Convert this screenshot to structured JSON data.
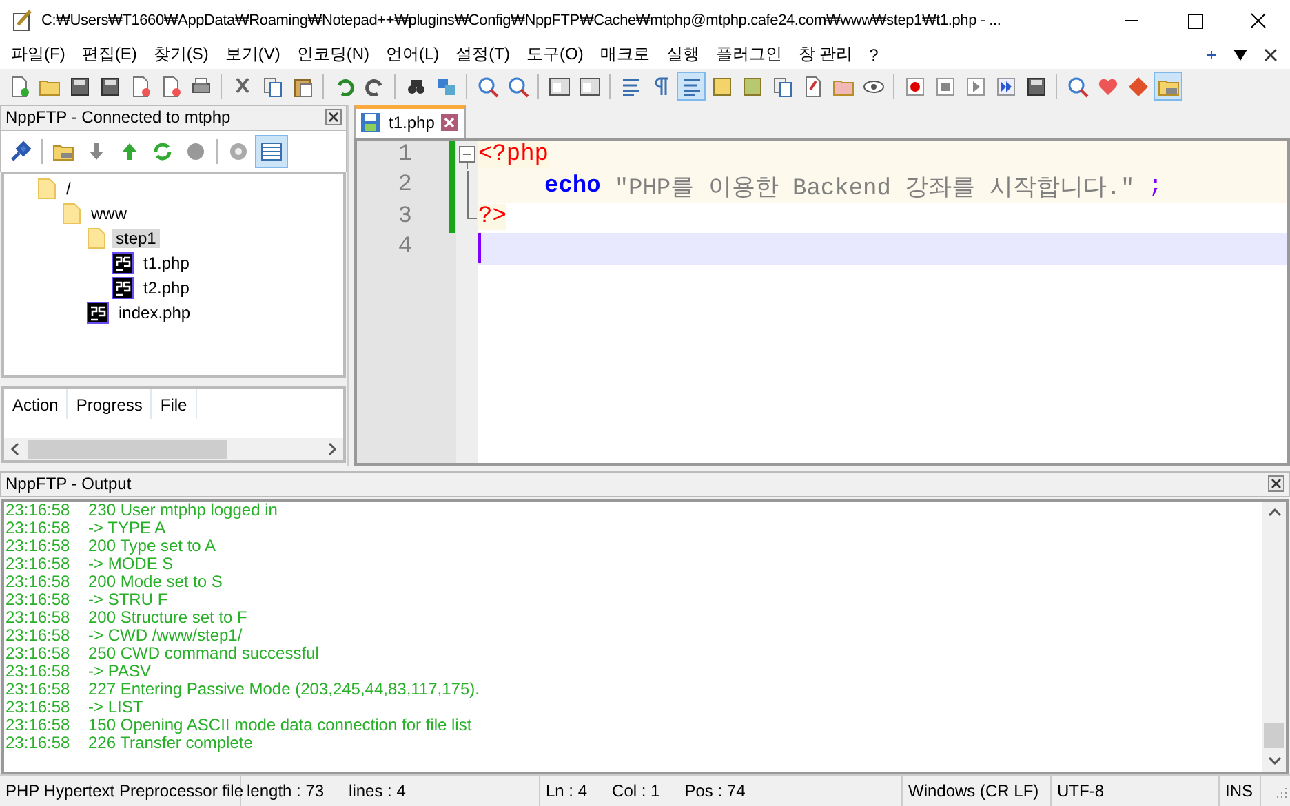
{
  "window": {
    "title": "C:₩Users₩T1660₩AppData₩Roaming₩Notepad++₩plugins₩Config₩NppFTP₩Cache₩mtphp@mtphp.cafe24.com₩www₩step1₩t1.php - ..."
  },
  "menu": [
    "파일(F)",
    "편집(E)",
    "찾기(S)",
    "보기(V)",
    "인코딩(N)",
    "언어(L)",
    "설정(T)",
    "도구(O)",
    "매크로",
    "실행",
    "플러그인",
    "창 관리",
    "?"
  ],
  "toolbar": [
    {
      "on": false
    },
    {
      "on": false
    },
    {
      "on": false
    },
    {
      "on": false
    },
    {
      "on": false
    },
    {
      "on": false
    },
    {
      "on": false
    },
    {
      "on": false
    },
    {
      "on": false
    },
    {
      "on": false
    },
    {
      "on": false
    },
    {
      "on": false
    },
    {
      "on": false
    },
    {
      "on": false
    },
    {
      "on": false
    },
    {
      "on": false
    },
    {
      "on": false
    },
    {
      "on": false
    },
    {
      "on": false
    },
    {
      "on": false
    },
    {
      "on": true
    },
    {
      "on": false
    },
    {
      "on": false
    },
    {
      "on": false
    },
    {
      "on": false
    },
    {
      "on": false
    },
    {
      "on": false
    },
    {
      "on": false
    },
    {
      "on": false
    },
    {
      "on": false
    },
    {
      "on": false
    },
    {
      "on": false
    },
    {
      "on": false
    },
    {
      "on": false
    },
    {
      "on": false
    },
    {
      "on": true
    }
  ],
  "ftp_panel": {
    "title": "NppFTP - Connected to mtphp",
    "toolbar": [
      {
        "on": false
      },
      {
        "on": false
      },
      {
        "on": false
      },
      {
        "on": false
      },
      {
        "on": false
      },
      {
        "on": false
      },
      {
        "on": false
      },
      {
        "on": true
      }
    ],
    "tree": [
      {
        "label": "/",
        "kind": "folder",
        "selected": false,
        "children": [
          {
            "label": "www",
            "kind": "folder",
            "selected": false,
            "children": [
              {
                "label": "step1",
                "kind": "folder",
                "selected": true,
                "children": [
                  {
                    "label": "t1.php",
                    "kind": "file",
                    "selected": false
                  },
                  {
                    "label": "t2.php",
                    "kind": "file",
                    "selected": false
                  }
                ]
              },
              {
                "label": "index.php",
                "kind": "file",
                "selected": false
              }
            ]
          }
        ]
      }
    ],
    "queue_columns": [
      "Action",
      "Progress",
      "File"
    ]
  },
  "tabs": [
    {
      "label": "t1.php",
      "selected": true
    }
  ],
  "editor": {
    "lines": [
      {
        "number": "1",
        "fold_open": true,
        "in_fold": false,
        "fold_close": false,
        "changed": true,
        "current": false,
        "block": true,
        "indented": false,
        "tokens": [
          {
            "kind": "tag",
            "text": "<?php"
          }
        ]
      },
      {
        "number": "2",
        "fold_open": false,
        "in_fold": true,
        "fold_close": false,
        "changed": true,
        "current": false,
        "block": true,
        "indented": true,
        "tokens": [
          {
            "kind": "keyword",
            "text": "echo"
          },
          {
            "kind": "string",
            "text": "\"PHP를 이용한 Backend 강좌를 시작합니다.\""
          },
          {
            "kind": "operator",
            "text": ";"
          }
        ]
      },
      {
        "number": "3",
        "fold_open": false,
        "in_fold": false,
        "fold_close": true,
        "changed": true,
        "current": false,
        "block": false,
        "indented": false,
        "tokens": [
          {
            "kind": "tag",
            "text": "?>"
          }
        ]
      },
      {
        "number": "4",
        "fold_open": false,
        "in_fold": false,
        "fold_close": false,
        "changed": false,
        "current": true,
        "block": false,
        "indented": false
      }
    ]
  },
  "output_panel": {
    "title": "NppFTP - Output",
    "lines": [
      {
        "time": "23:16:58",
        "message": "230 User mtphp logged in"
      },
      {
        "time": "23:16:58",
        "message": "-> TYPE A"
      },
      {
        "time": "23:16:58",
        "message": "200 Type set to A"
      },
      {
        "time": "23:16:58",
        "message": "-> MODE S"
      },
      {
        "time": "23:16:58",
        "message": "200 Mode set to S"
      },
      {
        "time": "23:16:58",
        "message": "-> STRU F"
      },
      {
        "time": "23:16:58",
        "message": "200 Structure set to F"
      },
      {
        "time": "23:16:58",
        "message": "-> CWD /www/step1/"
      },
      {
        "time": "23:16:58",
        "message": "250 CWD command successful"
      },
      {
        "time": "23:16:58",
        "message": "-> PASV"
      },
      {
        "time": "23:16:58",
        "message": "227 Entering Passive Mode (203,245,44,83,117,175)."
      },
      {
        "time": "23:16:58",
        "message": "-> LIST"
      },
      {
        "time": "23:16:58",
        "message": "150 Opening ASCII mode data connection for file list"
      },
      {
        "time": "23:16:58",
        "message": "226 Transfer complete"
      }
    ]
  },
  "status_bar": [
    {
      "items": [
        "PHP Hypertext Preprocessor file"
      ]
    },
    {
      "items": [
        "length : 73",
        "lines : 4"
      ]
    },
    {
      "items": [
        "Ln : 4",
        "Col : 1",
        "Pos : 74"
      ]
    },
    {
      "items": [
        "Windows (CR LF)"
      ]
    },
    {
      "items": [
        "UTF-8"
      ]
    },
    {
      "items": [
        "INS"
      ]
    }
  ]
}
